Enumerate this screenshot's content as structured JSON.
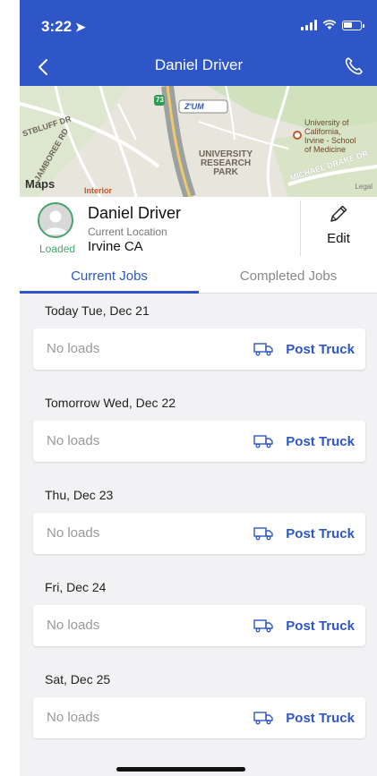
{
  "status_bar": {
    "time": "3:22"
  },
  "nav": {
    "title": "Daniel Driver"
  },
  "map": {
    "labels": {
      "bluff": "STBLUFF DR",
      "jamboree": "JAMBOREE RD",
      "research_park": "UNIVERSITY\nRESEARCH\nPARK",
      "uci": "University of\nCalifornia,\nIrvine - School\nof Medicine",
      "michael_drake": "MICHAEL DRAKE DR",
      "highway": "73",
      "zum": "Z'UM",
      "maps_logo": "Maps",
      "legal": "Legal",
      "interior": "Interior"
    }
  },
  "driver": {
    "name": "Daniel Driver",
    "status": "Loaded",
    "location_label": "Current Location",
    "location": "Irvine CA",
    "edit_label": "Edit"
  },
  "tabs": {
    "current": "Current Jobs",
    "completed": "Completed Jobs"
  },
  "days": [
    {
      "label": "Today Tue, Dec 21",
      "status": "No loads",
      "action": "Post Truck"
    },
    {
      "label": "Tomorrow Wed, Dec 22",
      "status": "No loads",
      "action": "Post Truck"
    },
    {
      "label": "Thu, Dec 23",
      "status": "No loads",
      "action": "Post Truck"
    },
    {
      "label": "Fri, Dec 24",
      "status": "No loads",
      "action": "Post Truck"
    },
    {
      "label": "Sat, Dec 25",
      "status": "No loads",
      "action": "Post Truck"
    }
  ],
  "colors": {
    "primary": "#2e56c7",
    "loaded": "#49a36d"
  }
}
